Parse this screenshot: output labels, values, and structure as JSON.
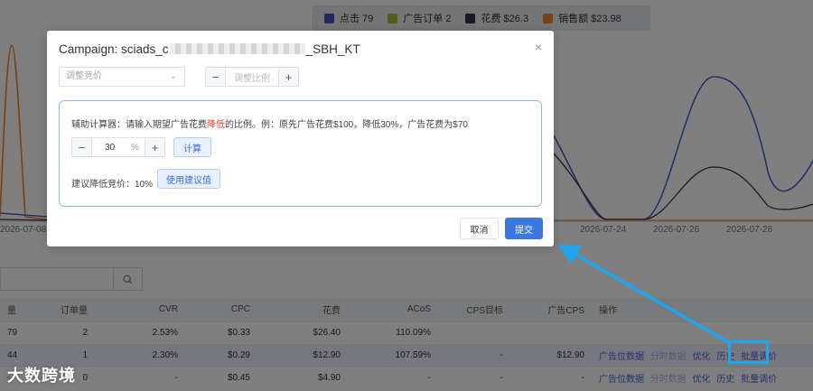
{
  "legend": [
    {
      "label": "点击 79",
      "color": "#3f57bd"
    },
    {
      "label": "广告订单 2",
      "color": "#a8bb2a"
    },
    {
      "label": "花费 $26.3",
      "color": "#33324a"
    },
    {
      "label": "销售额 $23.98",
      "color": "#e8893a"
    }
  ],
  "chart_data": {
    "type": "line",
    "x_ticks": [
      "2026-07-08",
      "2026-07-24",
      "2026-07-26",
      "2026-07-28"
    ],
    "series": [
      {
        "name": "点击",
        "color": "#4b62c9"
      },
      {
        "name": "花费",
        "color": "#333340"
      },
      {
        "name": "销售额",
        "color": "#e8893a"
      }
    ]
  },
  "search": {
    "placeholder": ""
  },
  "table": {
    "headers": [
      "量",
      "订单量",
      "CVR",
      "CPC",
      "花费",
      "ACoS",
      "CPS目标",
      "广告CPS",
      "操作"
    ],
    "rows": [
      [
        "79",
        "2",
        "2.53%",
        "$0.33",
        "$26.40",
        "110.09%",
        "",
        "",
        ""
      ],
      [
        "44",
        "1",
        "2.30%",
        "$0.29",
        "$12.90",
        "107.59%",
        "-",
        "$12.90",
        ""
      ],
      [
        "-",
        "0",
        "-",
        "$0.45",
        "$4.90",
        "-",
        "-",
        "-",
        ""
      ]
    ],
    "ops": [
      "广告位数据",
      "分时数据",
      "优化",
      "历史",
      "批量调价"
    ]
  },
  "watermark": "大数跨境",
  "modal": {
    "title_prefix": "Campaign: sciads_c",
    "title_suffix": "_SBH_KT",
    "close": "×",
    "select_placeholder": "调整竞价",
    "ratio_placeholder": "调整比例",
    "minus": "−",
    "plus": "+",
    "calc": {
      "desc_before": "辅助计算器：请输入期望广告花费",
      "desc_red": "降低",
      "desc_after": "的比例。例：原先广告花费$100，降低30%，广告花费为$70",
      "value": "30",
      "unit": "%",
      "calc_button": "计算",
      "suggest_label": "建议降低竞价：10%",
      "use_button": "使用建议值"
    },
    "cancel": "取消",
    "submit": "提交"
  }
}
